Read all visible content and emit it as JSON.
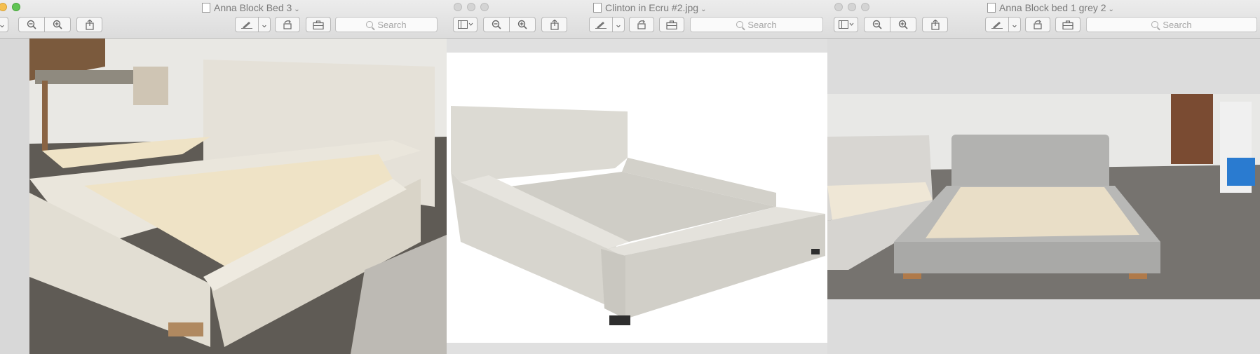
{
  "windows": [
    {
      "title": "Anna Block Bed 3",
      "search_placeholder": "Search"
    },
    {
      "title": "Clinton in Ecru #2.jpg",
      "search_placeholder": "Search"
    },
    {
      "title": "Anna Block bed 1 grey 2",
      "search_placeholder": "Search"
    }
  ],
  "icons": {
    "zoom_out": "zoom-out-icon",
    "zoom_in": "zoom-in-icon",
    "share": "share-icon",
    "markup": "markup-pen-icon",
    "rotate": "rotate-icon",
    "toolbox": "toolbox-icon",
    "sidebar": "sidebar-icon"
  }
}
